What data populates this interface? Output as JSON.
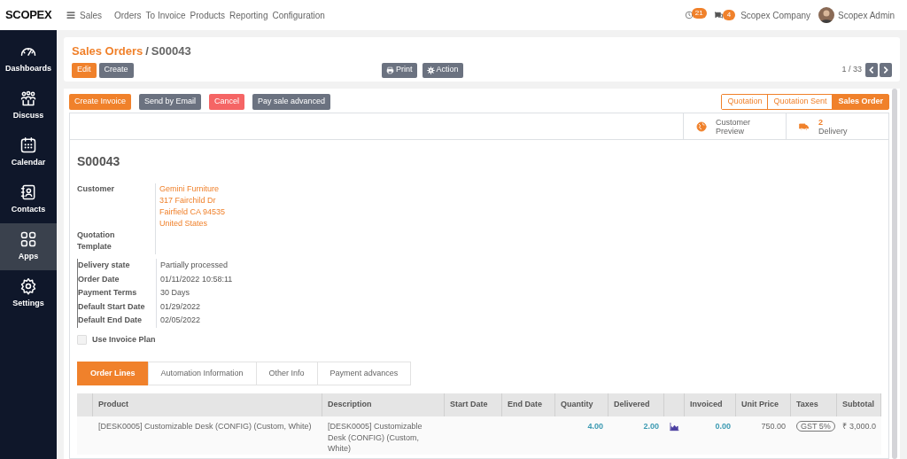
{
  "top_bar": {
    "logo": "SCOPEX",
    "app": "Sales",
    "menu": [
      "Orders",
      "To Invoice",
      "Products",
      "Reporting",
      "Configuration"
    ],
    "activity_count": "21",
    "message_count": "4",
    "company": "Scopex Company",
    "user": "Scopex Admin"
  },
  "sidebar": {
    "items": [
      {
        "label": "Dashboards",
        "kind": "gauge",
        "selected": false
      },
      {
        "label": "Discuss",
        "kind": "people",
        "selected": false
      },
      {
        "label": "Calendar",
        "kind": "calendar",
        "selected": false
      },
      {
        "label": "Contacts",
        "kind": "contact",
        "selected": false
      },
      {
        "label": "Apps",
        "kind": "grid",
        "selected": true
      },
      {
        "label": "Settings",
        "kind": "gear",
        "selected": false
      }
    ]
  },
  "breadcrumb": {
    "parent": "Sales Orders",
    "separator": "/",
    "current": "S00043"
  },
  "main_buttons": [
    {
      "label": "Edit",
      "kind": "primary"
    },
    {
      "label": "Create",
      "kind": "secondary"
    }
  ],
  "print": "Print",
  "action": "Action",
  "pager": "1 / 33",
  "header_buttons": [
    {
      "label": "Create Invoice",
      "kind": "primary"
    },
    {
      "label": "Send by Email",
      "kind": "secondary"
    },
    {
      "label": "Cancel",
      "kind": "danger"
    },
    {
      "label": "Pay sale advanced",
      "kind": "secondary"
    }
  ],
  "stages": [
    {
      "label": "Quotation",
      "selected": false
    },
    {
      "label": "Quotation Sent",
      "selected": false
    },
    {
      "label": "Sales Order",
      "selected": true
    }
  ],
  "smart_buttons": [
    {
      "kind": "preview",
      "label": "Customer Preview"
    },
    {
      "kind": "delivery",
      "count": "2",
      "label": "Delivery"
    }
  ],
  "title": "S00043",
  "customer": {
    "label": "Customer",
    "lines": [
      "Gemini Furniture",
      "317 Fairchild Dr",
      "Fairfield CA 94535",
      "United States"
    ]
  },
  "quotation_template": {
    "label": "Quotation Template"
  },
  "fields": [
    {
      "label": "Delivery state",
      "value": "Partially processed"
    },
    {
      "label": "Order Date",
      "value": "01/11/2022 10:58:11"
    },
    {
      "label": "Payment Terms",
      "value": "30 Days"
    },
    {
      "label": "Default Start Date",
      "value": "01/29/2022"
    },
    {
      "label": "Default End Date",
      "value": "02/05/2022"
    }
  ],
  "invoice_plan": {
    "label": "Use Invoice Plan",
    "checked": false
  },
  "tabs": [
    {
      "label": "Order Lines",
      "selected": true
    },
    {
      "label": "Automation Information",
      "selected": false
    },
    {
      "label": "Other Info",
      "selected": false
    },
    {
      "label": "Payment advances",
      "selected": false
    }
  ],
  "table": {
    "columns": [
      {
        "label": "Product",
        "kind": "text"
      },
      {
        "label": "Description",
        "kind": "text"
      },
      {
        "label": "Start Date",
        "kind": "text"
      },
      {
        "label": "End Date",
        "kind": "text"
      },
      {
        "label": "Quantity",
        "kind": "link"
      },
      {
        "label": "Delivered",
        "kind": "link"
      },
      {
        "kind": "icon"
      },
      {
        "label": "Invoiced",
        "kind": "link"
      },
      {
        "label": "Unit Price",
        "kind": "number"
      },
      {
        "label": "Taxes",
        "kind": "tag"
      },
      {
        "label": "Subtotal",
        "kind": "number"
      }
    ],
    "rows": [
      {
        "product": "[DESK0005] Customizable Desk (CONFIG) (Custom, White)",
        "description": "[DESK0005] Customizable Desk (CONFIG) (Custom, White)",
        "quantity": "4.00",
        "delivered": "2.00",
        "invoiced": "0.00",
        "unit_price": "750.00",
        "taxes": "GST 5%",
        "subtotal": "₹ 3,000.0"
      }
    ]
  }
}
